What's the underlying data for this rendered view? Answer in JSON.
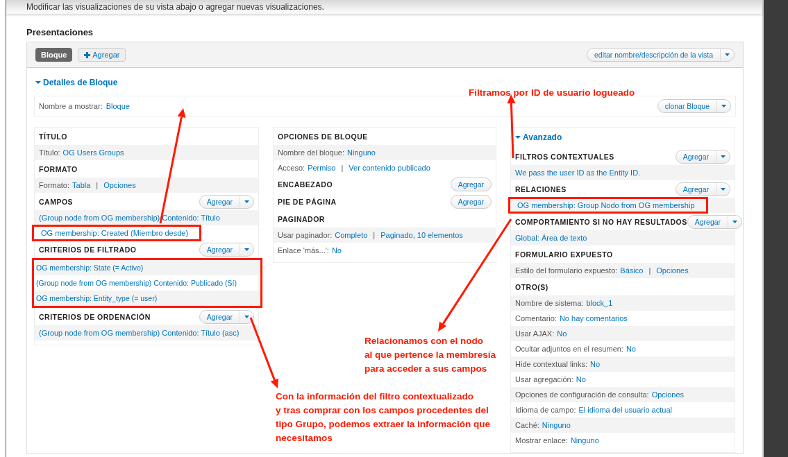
{
  "intro": "Modificar las visualizaciones de su vista abajo o agregar nuevas visualizaciones.",
  "heading": "Presentaciones",
  "tabs": [
    {
      "label": "Bloque",
      "selected": true
    }
  ],
  "add_display": "Agregar",
  "edit_view_button": "editar nombre/descripción de la vista",
  "details_toggle": {
    "label": "Detalles de Bloque",
    "expanded": true
  },
  "display_name": {
    "label": "Nombre a mostrar:",
    "value": "Bloque"
  },
  "clone_button": "clonar Bloque",
  "link_separator": "|",
  "columns": [
    {
      "sections": [
        {
          "title": "TÍTULO",
          "rows": [
            {
              "label": "Título:",
              "links": [
                "OG Users Groups"
              ]
            }
          ]
        },
        {
          "title": "FORMATO",
          "rows": [
            {
              "label": "Formato:",
              "links": [
                "Tabla",
                "Opciones"
              ]
            }
          ]
        },
        {
          "title": "CAMPOS",
          "add_button": {
            "label": "Agregar",
            "dropdown": true
          },
          "rows": [
            {
              "links": [
                "(Group node from OG membership) Contenido: Título"
              ]
            },
            {
              "links": [
                "OG membership: Created (Miembro desde)"
              ],
              "boxed": true
            }
          ]
        },
        {
          "title": "CRITERIOS DE FILTRADO",
          "add_button": {
            "label": "Agregar",
            "dropdown": true
          },
          "boxed_rows": true,
          "rows": [
            {
              "links": [
                "OG membership: State (= Activo)"
              ]
            },
            {
              "links": [
                "(Group node from OG membership) Contenido: Publicado (Sí)"
              ]
            },
            {
              "links": [
                "OG membership: Entity_type (= user)"
              ]
            }
          ]
        },
        {
          "title": "CRITERIOS DE ORDENACIÓN",
          "add_button": {
            "label": "Agregar",
            "dropdown": true
          },
          "rows": [
            {
              "links": [
                "(Group node from OG membership) Contenido: Título (asc)"
              ]
            }
          ]
        }
      ]
    },
    {
      "sections": [
        {
          "title": "OPCIONES DE BLOQUE",
          "rows": [
            {
              "label": "Nombre del bloque:",
              "links": [
                "Ninguno"
              ]
            },
            {
              "label": "Acceso:",
              "links": [
                "Permiso",
                "Ver contenido publicado"
              ]
            }
          ]
        },
        {
          "title": "ENCABEZADO",
          "add_button": {
            "label": "Agregar",
            "dropdown": false
          }
        },
        {
          "title": "PIE DE PÁGINA",
          "add_button": {
            "label": "Agregar",
            "dropdown": false
          }
        },
        {
          "title": "PAGINADOR",
          "rows": [
            {
              "label": "Usar paginador:",
              "links": [
                "Completo",
                "Paginado, 10 elementos"
              ]
            },
            {
              "label": "Enlace 'más...':",
              "links": [
                "No"
              ]
            }
          ]
        }
      ]
    },
    {
      "toggle": {
        "label": "Avanzado",
        "expanded": true
      },
      "sections": [
        {
          "title": "FILTROS CONTEXTUALES",
          "add_button": {
            "label": "Agregar",
            "dropdown": true
          },
          "rows": [
            {
              "links": [
                "We pass the user ID as the Entity ID."
              ]
            }
          ]
        },
        {
          "title": "RELACIONES",
          "add_button": {
            "label": "Agregar",
            "dropdown": true
          },
          "rows": [
            {
              "links": [
                "OG membership: Group Nodo from OG membership"
              ],
              "boxed": true
            }
          ]
        },
        {
          "title": "COMPORTAMIENTO SI NO HAY RESULTADOS",
          "add_button": {
            "label": "Agregar",
            "dropdown": true
          },
          "rows": [
            {
              "links": [
                "Global: Área de texto"
              ]
            }
          ]
        },
        {
          "title": "FORMULARIO EXPUESTO",
          "rows": [
            {
              "label": "Estilo del formulario expuesto:",
              "links": [
                "Básico",
                "Opciones"
              ]
            }
          ]
        },
        {
          "title": "OTRO(S)",
          "rows": [
            {
              "label": "Nombre de sistema:",
              "links": [
                "block_1"
              ]
            },
            {
              "label": "Comentario:",
              "links": [
                "No hay comentarios"
              ]
            },
            {
              "label": "Usar AJAX:",
              "links": [
                "No"
              ]
            },
            {
              "label": "Ocultar adjuntos en el resumen:",
              "links": [
                "No"
              ]
            },
            {
              "label": "Hide contextual links:",
              "links": [
                "No"
              ]
            },
            {
              "label": "Usar agregación:",
              "links": [
                "No"
              ]
            },
            {
              "label": "Opciones de configuración de consulta:",
              "links": [
                "Opciones"
              ]
            },
            {
              "label": "Idioma de campo:",
              "links": [
                "El idioma del usuario actual"
              ]
            },
            {
              "label": "Caché:",
              "links": [
                "Ninguno"
              ]
            },
            {
              "label": "Mostrar enlace:",
              "links": [
                "Ninguno"
              ]
            }
          ]
        }
      ]
    }
  ],
  "annotations": [
    {
      "lines": [
        "Filtramos por ID de usuario logueado"
      ]
    },
    {
      "lines": [
        "Relacionamos con el nodo",
        "al que pertence la membresía",
        "para acceder a sus campos"
      ]
    },
    {
      "lines": [
        "Con la información del filtro contextualizado",
        "y tras comprar con los campos procedentes del",
        "tipo Grupo, podemos extraer la información que",
        "necesitamos"
      ]
    }
  ]
}
